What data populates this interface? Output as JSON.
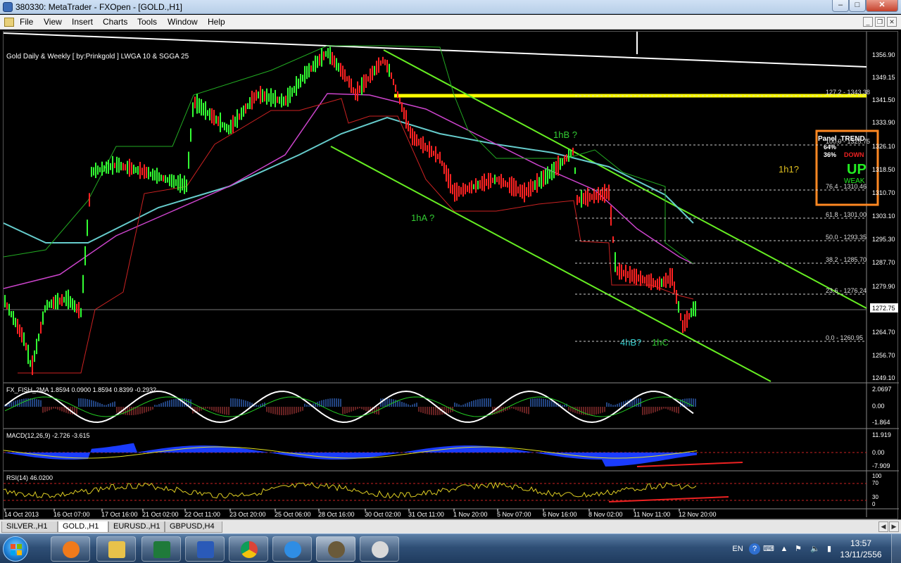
{
  "window": {
    "title": "380330: MetaTrader - FXOpen - [GOLD.,H1]",
    "buttons": {
      "minimize": "–",
      "maximize": "□",
      "close": "✕"
    }
  },
  "menu": {
    "items": [
      "File",
      "View",
      "Insert",
      "Charts",
      "Tools",
      "Window",
      "Help"
    ],
    "mdi_buttons": [
      "_",
      "❐",
      "✕"
    ]
  },
  "chart": {
    "header": "Gold Daily & Weekly [ by:Prinkgold ] LWGA 10  &  SGGA 25",
    "current_price": "1272.75",
    "price_ticks": [
      "1356.90",
      "1349.15",
      "1341.50",
      "1333.90",
      "1326.10",
      "1318.50",
      "1310.70",
      "1303.10",
      "1295.30",
      "1287.70",
      "1279.90",
      "1272.75",
      "1264.70",
      "1256.70",
      "1249.10"
    ],
    "fib_levels": [
      "127.2 - 1343.38",
      "100.0 - 1325.75",
      "76.4 - 1310.46",
      "61.8 - 1301.00",
      "50.0 - 1293.35",
      "38.2 - 1285.70",
      "23.6 - 1276.24",
      "0.0 - 1260.95"
    ],
    "time_labels": [
      "14 Oct 2013",
      "16 Oct 07:00",
      "17 Oct 16:00",
      "21 Oct 02:00",
      "22 Oct 11:00",
      "23 Oct 20:00",
      "25 Oct 06:00",
      "28 Oct 16:00",
      "30 Oct 02:00",
      "31 Oct 11:00",
      "1 Nov 20:00",
      "5 Nov 07:00",
      "6 Nov 16:00",
      "8 Nov 02:00",
      "11 Nov 11:00",
      "12 Nov 20:00"
    ],
    "annotations": {
      "wave_1hb": "1hB ?",
      "wave_1ha": "1hA ?",
      "wave_1h1": "1h1?",
      "wave_4hb": "4hB?",
      "wave_1hc": "1hC"
    },
    "colors": {
      "bull_candle": "#33ff33",
      "bear_candle": "#ff2222",
      "channel": "#66ee22",
      "resistance": "#ffff00",
      "ma_cyan": "#66cccc",
      "ma_magenta": "#cc44cc",
      "trend_white": "#ffffff",
      "panel_border": "#ff8822"
    }
  },
  "panel_trend": {
    "title": "Panel_TREND",
    "pct_a": "64%",
    "pct_b": "36%",
    "down": "DOWN",
    "up": "UP",
    "weak": "WEAK"
  },
  "fisher": {
    "header": "FX_FISH_2MA 1.8594 0.0900 1.8594 0.8399 -0.2932",
    "ticks": [
      "2.0697",
      "0.00",
      "-1.864"
    ]
  },
  "macd": {
    "header": "MACD(12,26,9) -2.726 -3.615",
    "ticks": [
      "11.919",
      "0.00",
      "-7.909"
    ]
  },
  "rsi": {
    "header": "RSI(14) 46.0200",
    "ticks": [
      "100",
      "70",
      "30",
      "0"
    ]
  },
  "tabs": [
    {
      "label": "SILVER.,H1",
      "active": false
    },
    {
      "label": "GOLD.,H1",
      "active": true
    },
    {
      "label": "EURUSD.,H1",
      "active": false
    },
    {
      "label": "GBPUSD,H4",
      "active": false
    }
  ],
  "taskbar": {
    "apps": [
      "media-player",
      "file-explorer",
      "excel",
      "word",
      "chrome",
      "internet-explorer",
      "metatrader",
      "paint"
    ],
    "language": "EN",
    "time": "13:57",
    "date": "13/11/2556"
  }
}
